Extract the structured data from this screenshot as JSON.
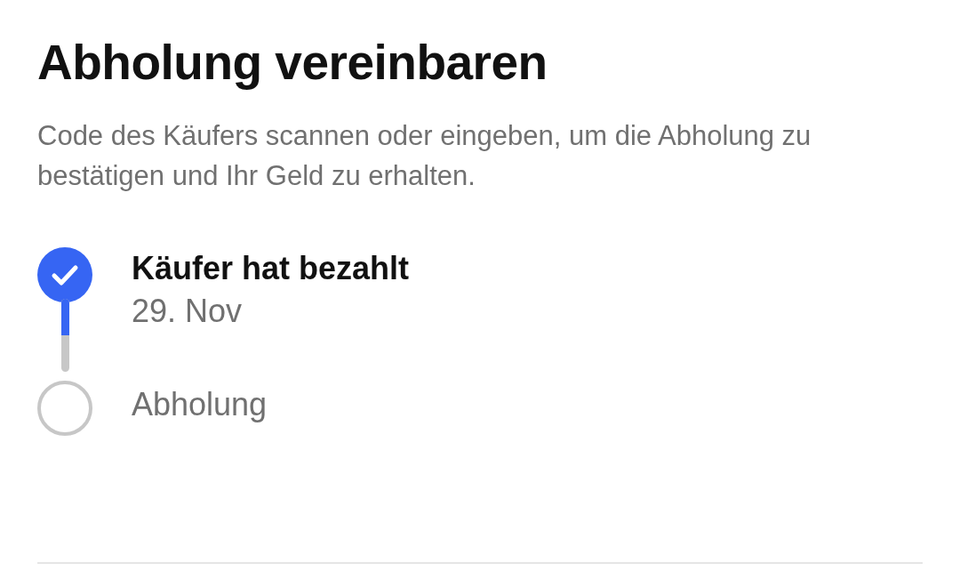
{
  "title": "Abholung vereinbaren",
  "description": "Code des Käufers scannen oder eingeben, um die Abholung zu bestätigen und Ihr Geld zu erhalten.",
  "steps": [
    {
      "label": "Käufer hat bezahlt",
      "date": "29. Nov",
      "completed": true
    },
    {
      "label": "Abholung",
      "completed": false
    }
  ],
  "connector": {
    "level": 0.5
  }
}
